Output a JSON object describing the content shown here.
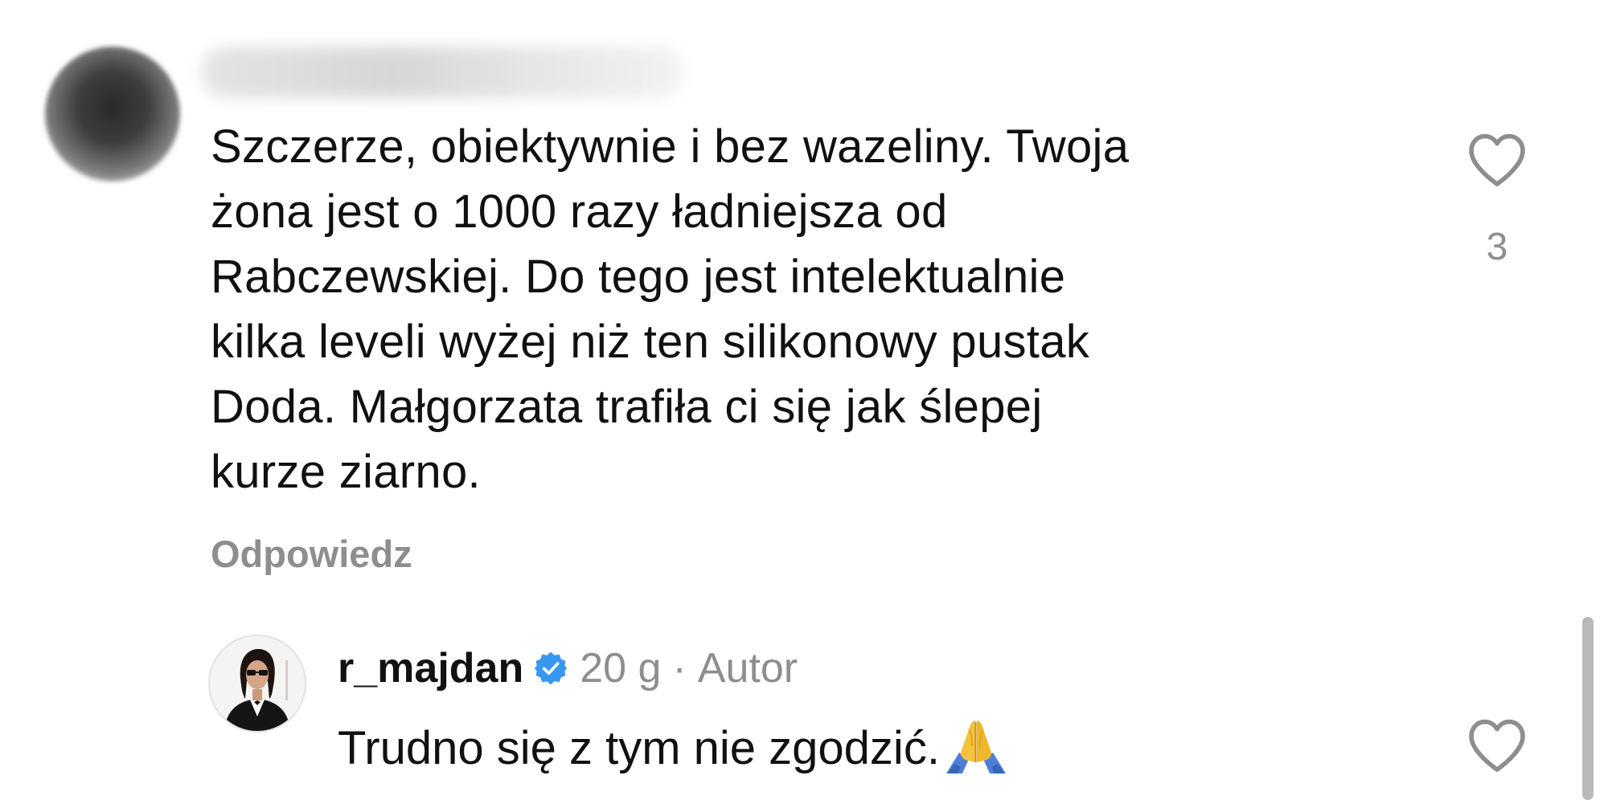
{
  "comment": {
    "text_lines": [
      "Szczerze, obiektywnie i bez wazeliny. Twoja",
      "żona jest o 1000 razy ładniejsza od",
      "Rabczewskiej. Do tego jest intelektualnie",
      "kilka leveli wyżej niż ten silikonowy pustak",
      "Doda. Małgorzata trafiła ci się jak ślepej",
      "kurze ziarno."
    ],
    "reply_label": "Odpowiedz",
    "like_count": "3",
    "icons": {
      "avatar": "blurred-avatar",
      "name": "blurred-username",
      "like": "heart-icon"
    }
  },
  "reply": {
    "username": "r_majdan",
    "age": "20 g",
    "separator": "·",
    "author_label": "Autor",
    "text": "Trudno się z tym nie zgodzić.",
    "icons": {
      "verified": "verified-badge-icon",
      "emoji": "folded-hands-emoji",
      "like": "heart-icon"
    }
  },
  "colors": {
    "text": "#111111",
    "muted": "#8e8e8e",
    "verified": "#3897f0",
    "background": "#ffffff"
  }
}
